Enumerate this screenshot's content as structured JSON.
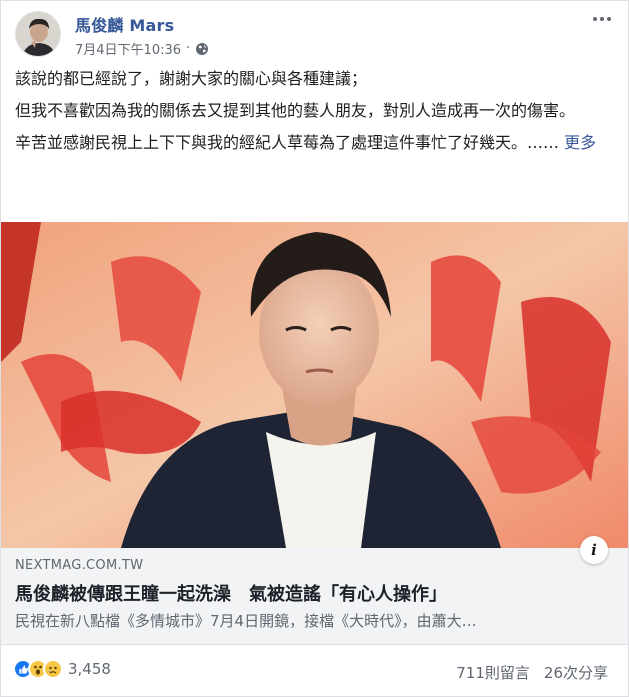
{
  "post": {
    "author": "馬俊麟 Mars",
    "timestamp": "7月4日下午10:36",
    "separator": "·",
    "privacy_icon": "globe-icon",
    "menu_icon": "more-options-icon",
    "paragraphs": [
      "該說的都已經說了，謝謝大家的關心與各種建議；",
      "但我不喜歡因為我的關係去又提到其他的藝人朋友，對別人造成再一次的傷害。",
      "辛苦並感謝民視上上下下與我的經紀人草莓為了處理這件事忙了好幾天。……"
    ],
    "see_more": "更多"
  },
  "link_preview": {
    "domain": "NEXTMAG.COM.TW",
    "headline": "馬俊麟被傳跟王瞳一起洗澡　氣被造謠「有心人操作」",
    "description": "民視在新八點檔《多情城市》7月4日開鏡，接檔《大時代》，由蕭大…",
    "info_icon": "i"
  },
  "engagement": {
    "reaction_icons": [
      "like-icon",
      "wow-icon",
      "sad-icon"
    ],
    "reaction_count": "3,458",
    "comments": "711則留言",
    "shares": "26次分享"
  },
  "colors": {
    "author_blue": "#365899",
    "link_blue": "#385898",
    "meta_gray": "#606770",
    "preview_bg": "#f2f3f5"
  }
}
